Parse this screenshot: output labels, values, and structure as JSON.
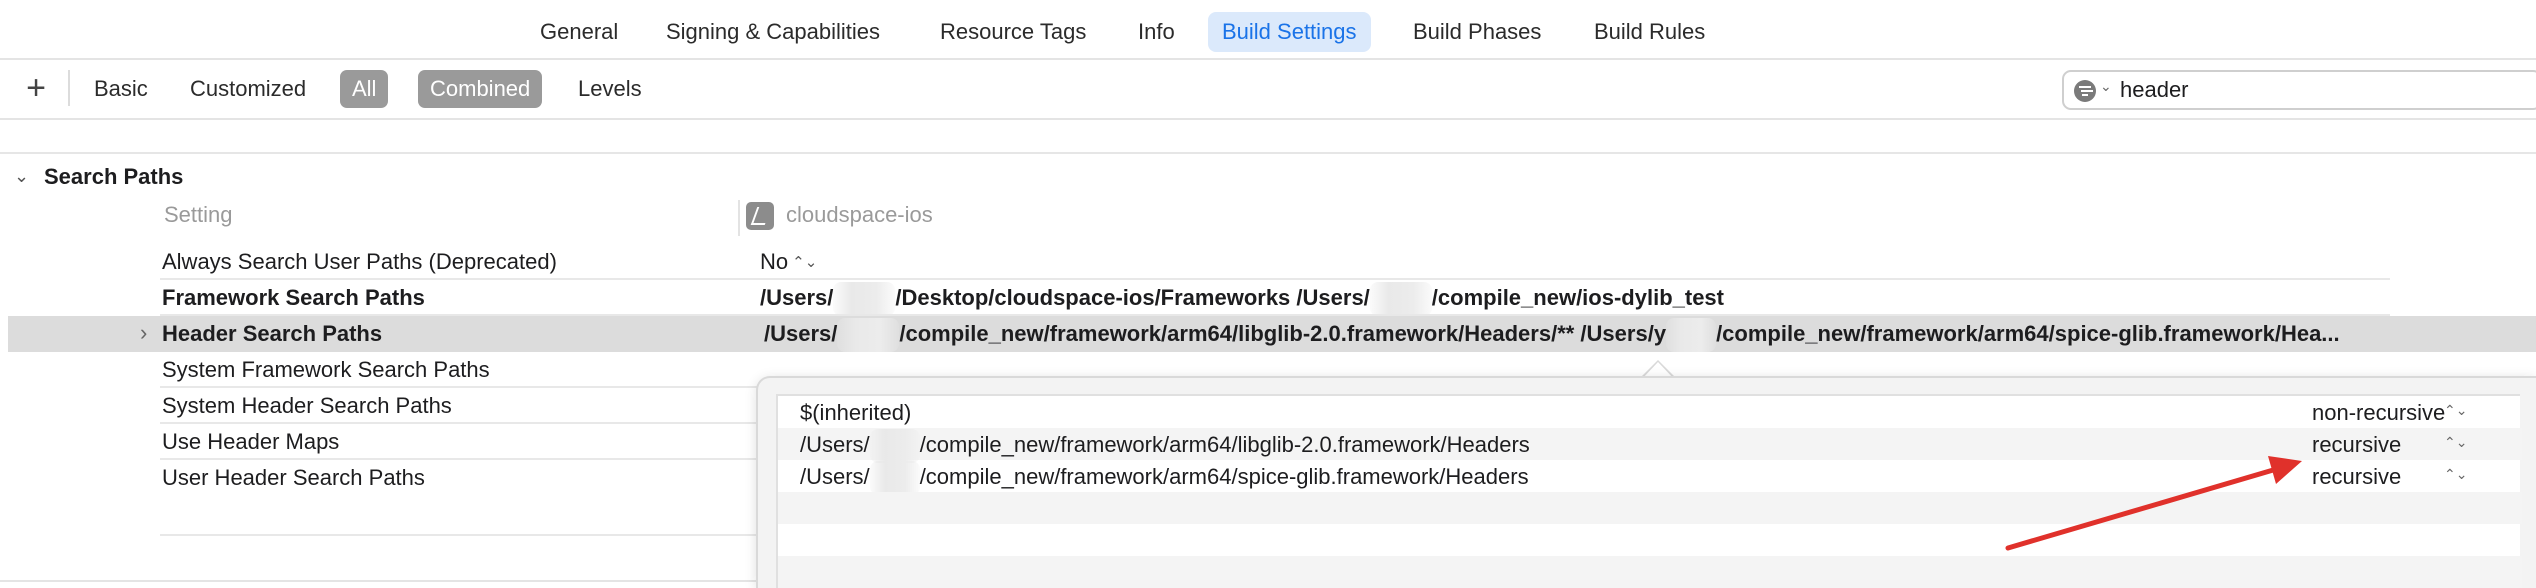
{
  "tabs": [
    {
      "label": "General",
      "active": false
    },
    {
      "label": "Signing & Capabilities",
      "active": false
    },
    {
      "label": "Resource Tags",
      "active": false
    },
    {
      "label": "Info",
      "active": false
    },
    {
      "label": "Build Settings",
      "active": true
    },
    {
      "label": "Build Phases",
      "active": false
    },
    {
      "label": "Build Rules",
      "active": false
    }
  ],
  "toolbar": {
    "add_label": "+",
    "filters": [
      "Basic",
      "Customized",
      "All",
      "Combined",
      "Levels"
    ],
    "selected_scope": "All",
    "selected_view": "Combined"
  },
  "search": {
    "value": "header"
  },
  "section": {
    "title": "Search Paths",
    "column_setting": "Setting",
    "column_target": "cloudspace-ios",
    "rows": [
      {
        "name": "Always Search User Paths (Deprecated)",
        "value": "No",
        "bold": false
      },
      {
        "name": "Framework Search Paths",
        "value_parts": [
          "/Users/",
          "/Desktop/cloudspace-ios/Frameworks  /Users/",
          "/compile_new/ios-dylib_test"
        ],
        "bold": true
      },
      {
        "name": "Header Search Paths",
        "value_parts": [
          "/Users/",
          "/compile_new/framework/arm64/libglib-2.0.framework/Headers/** /Users/y",
          "/compile_new/framework/arm64/spice-glib.framework/Hea..."
        ],
        "bold": true,
        "selected": true
      },
      {
        "name": "System Framework Search Paths",
        "bold": false
      },
      {
        "name": "System Header Search Paths",
        "bold": false
      },
      {
        "name": "Use Header Maps",
        "bold": false
      },
      {
        "name": "User Header Search Paths",
        "bold": false
      }
    ]
  },
  "popover": {
    "rows": [
      {
        "path": "$(inherited)",
        "mode": "non-recursive"
      },
      {
        "path_parts": [
          "/Users/",
          "/compile_new/framework/arm64/libglib-2.0.framework/Headers"
        ],
        "mode": "recursive"
      },
      {
        "path_parts": [
          "/Users/",
          "/compile_new/framework/arm64/spice-glib.framework/Headers"
        ],
        "mode": "recursive"
      }
    ]
  },
  "colors": {
    "active_tab_bg": "#dbe9fb",
    "active_tab_text": "#1a73e8",
    "filter_selected_bg": "#9a9a9a",
    "row_selected_bg": "#dcdcdc",
    "annotation_arrow": "#e0312b"
  },
  "icons": {
    "filter": "filter-icon",
    "target": "app-target-icon",
    "disclosure": "chevron-right-icon",
    "stepper": "up-down-chevron-icon"
  }
}
